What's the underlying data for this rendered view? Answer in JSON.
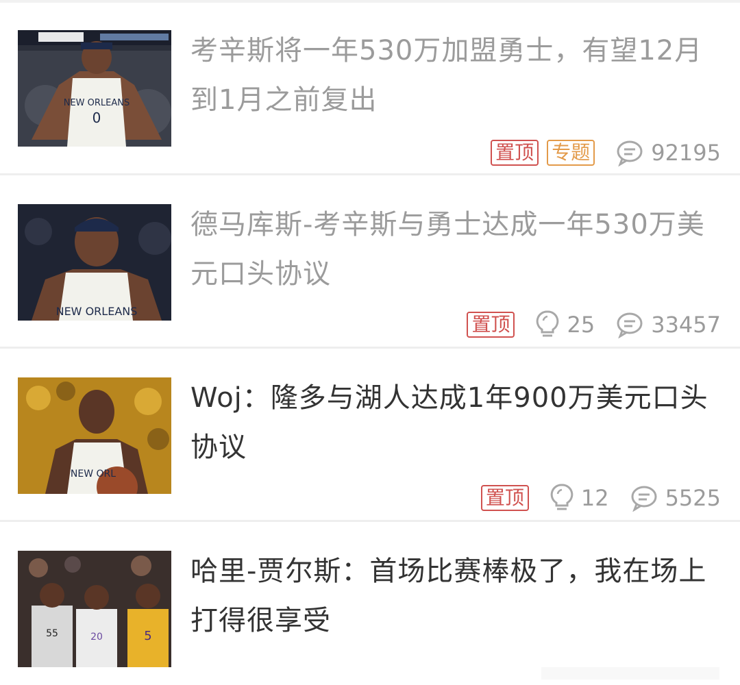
{
  "feed": [
    {
      "title": "考辛斯将一年530万加盟勇士，有望12月到1月之前复出",
      "read": true,
      "thumbnail_icon": "player-photo-new-orleans-jersey-0",
      "tags": [
        {
          "label": "置顶",
          "color": "#d0514f"
        },
        {
          "label": "专题",
          "color": "#e39a49"
        }
      ],
      "light_count": null,
      "comment_count": "92195"
    },
    {
      "title": "德马库斯-考辛斯与勇士达成一年530万美元口头协议",
      "read": true,
      "thumbnail_icon": "player-portrait-new-orleans",
      "tags": [
        {
          "label": "置顶",
          "color": "#d0514f"
        }
      ],
      "light_count": "25",
      "comment_count": "33457"
    },
    {
      "title": "Woj：隆多与湖人达成1年900万美元口头协议",
      "read": false,
      "thumbnail_icon": "player-portrait-with-basketball",
      "tags": [
        {
          "label": "置顶",
          "color": "#d0514f"
        }
      ],
      "light_count": "12",
      "comment_count": "5525"
    },
    {
      "title": "哈里-贾尔斯：首场比赛棒极了，我在场上打得很享受",
      "read": false,
      "thumbnail_icon": "players-on-court-kings",
      "tags": [],
      "light_count": null,
      "comment_count": null
    }
  ],
  "colors": {
    "read_title": "#9b9b9b",
    "unread_title": "#333333",
    "meta_gray": "#9b9b9b",
    "pin_tag": "#d0514f",
    "topic_tag": "#e39a49"
  },
  "icons": {
    "light": "lightbulb-icon",
    "comment": "comment-bubble-icon"
  }
}
